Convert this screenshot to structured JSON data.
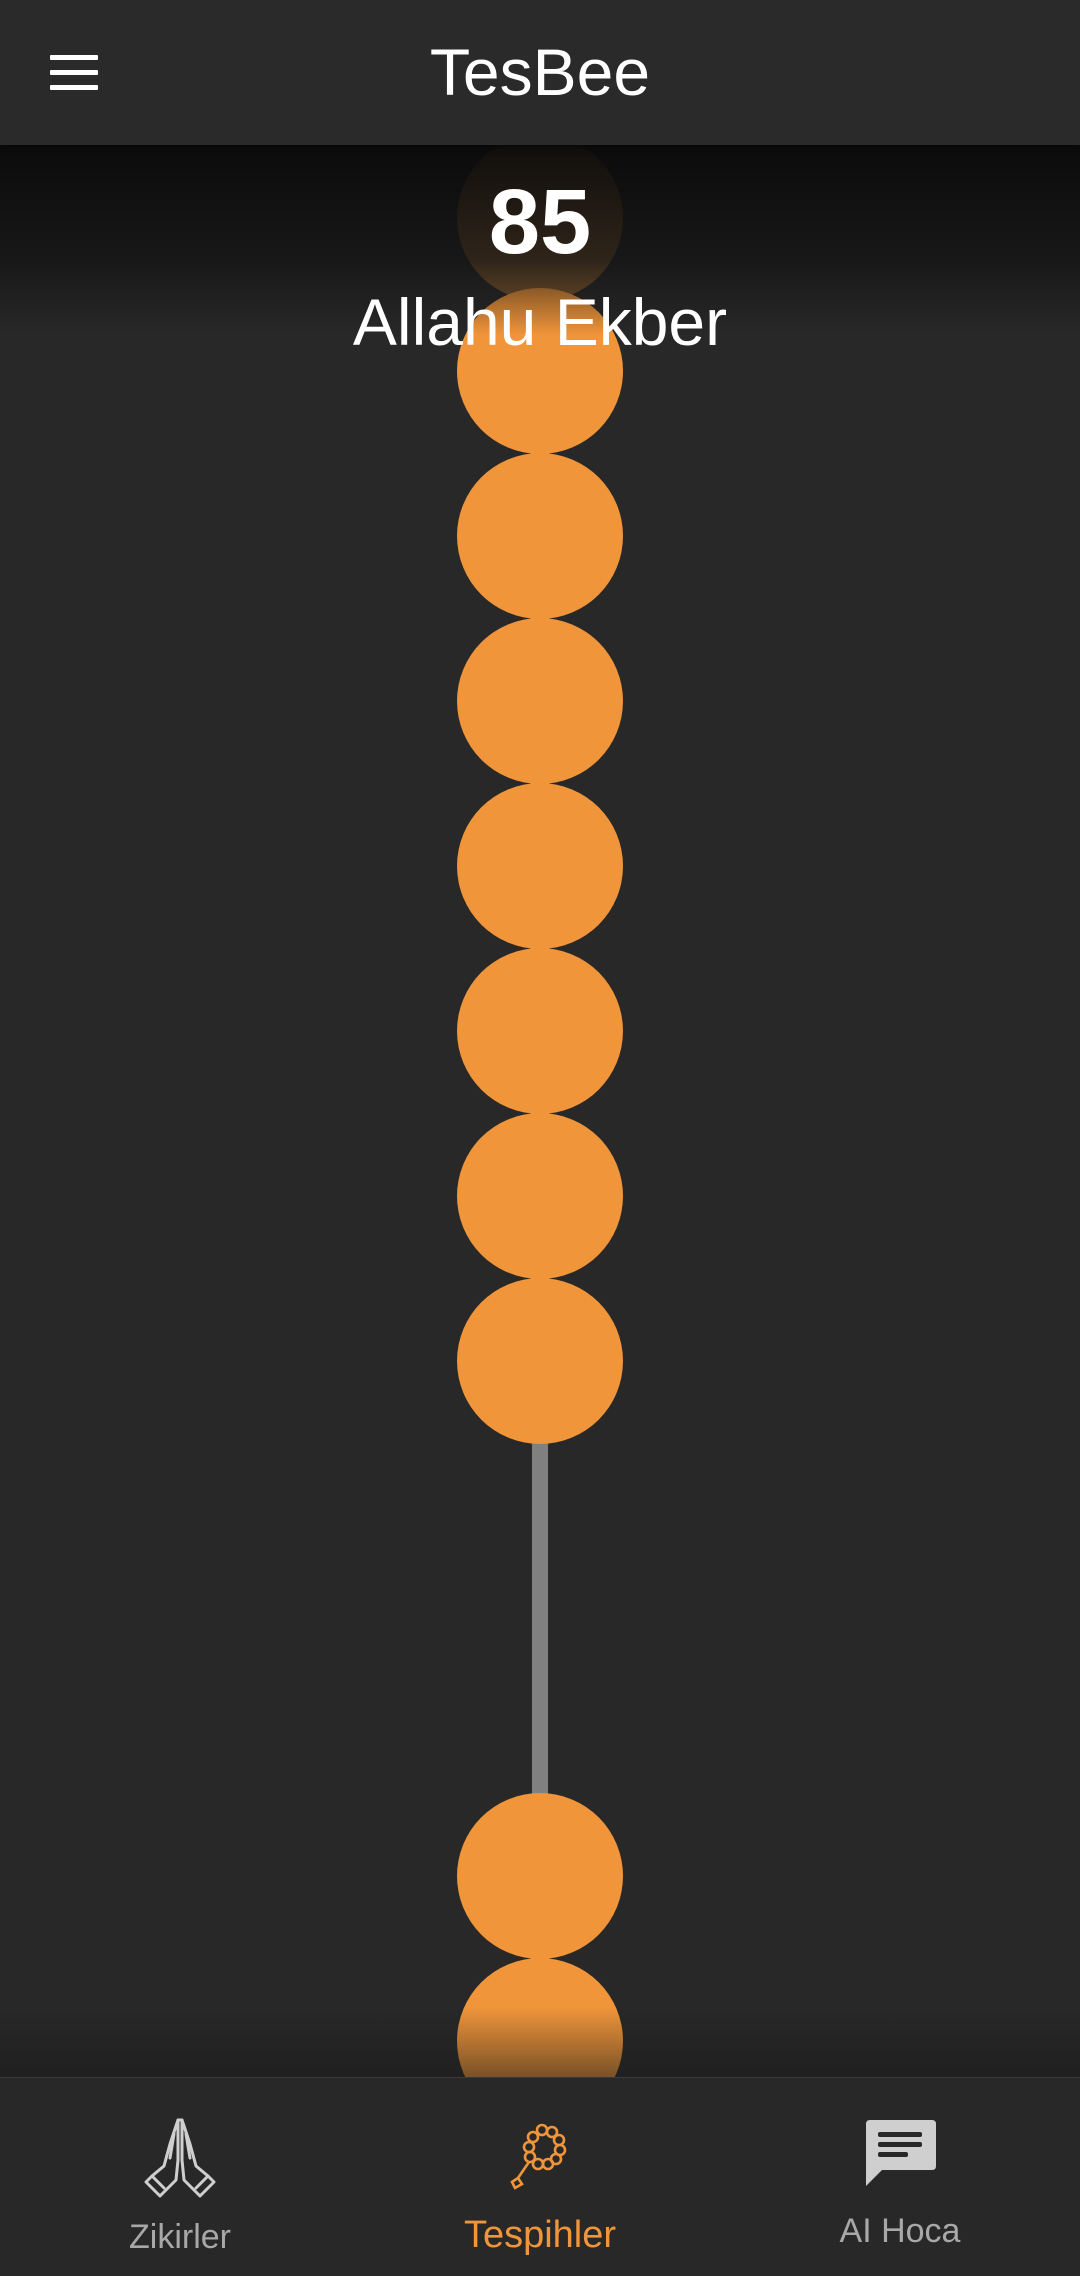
{
  "app": {
    "title": "TesBee"
  },
  "counter": {
    "count": "85",
    "zikr": "Allahu Ekber"
  },
  "colors": {
    "accent": "#f0953a",
    "background": "#282828",
    "string": "#808080",
    "inactive": "#a8a8a8"
  },
  "nav": {
    "items": [
      {
        "label": "Zikirler",
        "icon": "praying-hands-icon",
        "active": false
      },
      {
        "label": "Tespihler",
        "icon": "prayer-beads-icon",
        "active": true
      },
      {
        "label": "AI Hoca",
        "icon": "chat-bubble-icon",
        "active": false
      }
    ]
  }
}
